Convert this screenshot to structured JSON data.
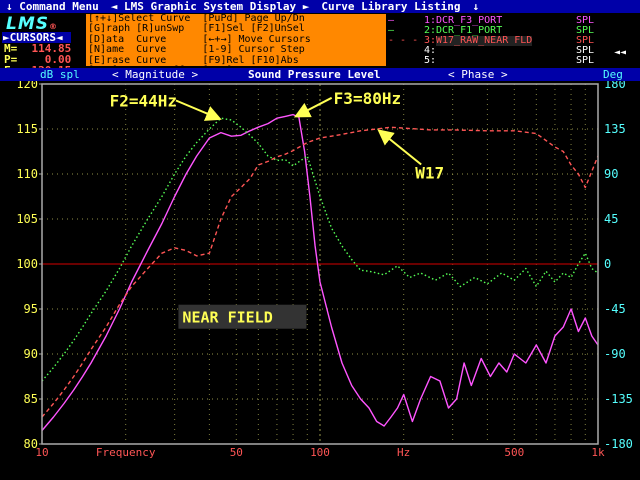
{
  "menubar": {
    "items": [
      {
        "label": "↓ Command Menu",
        "color": "#ffffff"
      },
      {
        "label": "◄ LMS Graphic System Display ►",
        "color": "#ffffff"
      },
      {
        "label": "Curve Library Listing",
        "color": "#ffffff"
      },
      {
        "label": "↓",
        "color": "#ffffff"
      }
    ]
  },
  "logo": {
    "text": "LMS",
    "mark": "®"
  },
  "cursors": {
    "title": "►CURSORS◄",
    "m_label": "M=",
    "m_value": "114.85",
    "p_label": "P=",
    "p_value": "0.00",
    "f_label": "F=",
    "f_value": "120.15"
  },
  "help_lines": [
    "[↑+↓]Select Curve  [PuPd] Page Up/Dn",
    "[G]raph [R]unSwp   [F1]Sel [F2]UnSel",
    "[D]ata  Curve      [←+→] Move Cursors",
    "[N]ame  Curve      [1-9] Cursor Step",
    "[E]rase Curve      [F9]Rel [F10]Abs",
    "[INS] Osc On/Off   [ESC] System Menu"
  ],
  "legend": {
    "rows": [
      {
        "num": "1:",
        "name": "DCR_F3_PORT",
        "type": "SPL",
        "color": "#ff55ff",
        "marker": "—"
      },
      {
        "num": "2:",
        "name": "DCR_F1_PORT",
        "type": "SPL",
        "color": "#55ff55",
        "marker": "—"
      },
      {
        "num": "3:",
        "name": "W17_RAW_NEAR FLD",
        "type": "SPL",
        "color": "#ff5555",
        "marker": "- - -",
        "selected": true
      },
      {
        "num": "4:",
        "name": "",
        "type": "SPL",
        "color": "#ffffff",
        "marker": ""
      },
      {
        "num": "5:",
        "name": "",
        "type": "SPL",
        "color": "#ffffff",
        "marker": ""
      }
    ],
    "scroll_icon": "◄◄"
  },
  "header": {
    "left_unit": "dB spl",
    "magnitude_tab": "< Magnitude >",
    "title": "Sound Pressure Level",
    "phase_tab": "< Phase >",
    "right_unit": "Deg"
  },
  "colors": {
    "plot_bg": "#000000",
    "frame": "#aaaaaa",
    "axis_left": "#ffff55",
    "axis_right": "#55ffff",
    "x_ticks": "#ff5555",
    "grid": "#aaaa55",
    "ref_line": "#aa0000",
    "annotation": "#ffff55"
  },
  "chart_data": {
    "type": "line",
    "title": "Sound Pressure Level",
    "xlabel": "Frequency",
    "x_unit": "Hz",
    "ylabel": "dB spl",
    "y2label": "Deg",
    "xscale": "log",
    "xlim": [
      10,
      1000
    ],
    "ylim": [
      80,
      120
    ],
    "y2lim": [
      -180,
      180
    ],
    "grid": true,
    "x_ticks": [
      {
        "value": 10,
        "label": "10"
      },
      {
        "value": 50,
        "label": "50"
      },
      {
        "value": 100,
        "label": "100"
      },
      {
        "value": 200,
        "label": "Hz"
      },
      {
        "value": 500,
        "label": "500"
      },
      {
        "value": 1000,
        "label": "1k"
      }
    ],
    "xlabel_at": 20,
    "y_ticks": [
      80,
      85,
      90,
      95,
      100,
      105,
      110,
      115,
      120
    ],
    "y2_ticks": [
      -180,
      -135,
      -90,
      -45,
      0,
      45,
      90,
      135,
      180
    ],
    "reference_line_y": 100,
    "annotations": [
      {
        "text": "F2=44Hz",
        "x": 17.5,
        "y": 117.5,
        "arrow_to": [
          43,
          116.2
        ]
      },
      {
        "text": "F3=80Hz",
        "x": 112,
        "y": 117.8,
        "arrow_to": [
          83,
          116.5
        ]
      },
      {
        "text": "W17",
        "x": 220,
        "y": 109.5,
        "arrow_to": [
          165,
          114.7
        ]
      },
      {
        "text": "NEAR FIELD",
        "x": 32,
        "y": 93.7,
        "boxed": true
      }
    ],
    "series": [
      {
        "name": "DCR_F3_PORT",
        "color": "#ff55ff",
        "style": "solid",
        "x": [
          10,
          11,
          12,
          13,
          14,
          15,
          17,
          19,
          21,
          24,
          27,
          30,
          33,
          36,
          40,
          44,
          48,
          52,
          56,
          60,
          65,
          70,
          75,
          80,
          84,
          88,
          92,
          96,
          100,
          110,
          120,
          130,
          140,
          150,
          160,
          170,
          180,
          190,
          200,
          215,
          230,
          250,
          270,
          290,
          310,
          330,
          350,
          380,
          410,
          440,
          470,
          500,
          550,
          600,
          650,
          700,
          750,
          800,
          850,
          900,
          950,
          1000
        ],
        "y": [
          81.5,
          83,
          84.5,
          86,
          87.5,
          89,
          92,
          95,
          98,
          101.5,
          104.5,
          107.5,
          110,
          112,
          114,
          114.6,
          114.2,
          114.3,
          114.8,
          115.2,
          115.6,
          116.2,
          116.4,
          116.6,
          116.3,
          112.5,
          107.5,
          102,
          98,
          93,
          89,
          86.5,
          85,
          84,
          82.5,
          82,
          83,
          84,
          85.5,
          82.5,
          85,
          87.5,
          87,
          84,
          85,
          89,
          86.5,
          89.5,
          87.5,
          89,
          88,
          90,
          89,
          91,
          89,
          92,
          93,
          95,
          92.5,
          94,
          92,
          91
        ]
      },
      {
        "name": "DCR_F1_PORT",
        "color": "#55ff55",
        "style": "dotted",
        "x": [
          10,
          11,
          12,
          13,
          14,
          15,
          17,
          19,
          21,
          24,
          27,
          30,
          33,
          36,
          40,
          44,
          48,
          52,
          56,
          60,
          65,
          70,
          75,
          80,
          90,
          100,
          110,
          120,
          130,
          140,
          150,
          170,
          190,
          210,
          230,
          260,
          290,
          320,
          360,
          400,
          450,
          500,
          550,
          600,
          650,
          700,
          750,
          800,
          850,
          900,
          950,
          1000
        ],
        "y": [
          87,
          88.5,
          90,
          91.5,
          93,
          94.5,
          97,
          99.5,
          102,
          105,
          107.5,
          110,
          112,
          113.5,
          115,
          116.2,
          116,
          115.2,
          114.3,
          113.4,
          112,
          111.5,
          111.6,
          110.9,
          112,
          107.5,
          104,
          102,
          100.5,
          99.3,
          99.2,
          98.8,
          99.8,
          98.5,
          99,
          98.2,
          99,
          97.5,
          98.5,
          97.8,
          99,
          98.2,
          99.5,
          97.5,
          99.2,
          98,
          99,
          98.5,
          100,
          101.2,
          99.5,
          99
        ]
      },
      {
        "name": "W17_RAW_NEAR FLD",
        "color": "#ff5555",
        "style": "dashed",
        "x": [
          10,
          11,
          12,
          13,
          14,
          15,
          17,
          19,
          21,
          24,
          27,
          30,
          33,
          36,
          40,
          44,
          48,
          52,
          56,
          60,
          65,
          70,
          75,
          80,
          90,
          100,
          110,
          120,
          140,
          160,
          180,
          200,
          250,
          300,
          400,
          500,
          600,
          700,
          750,
          800,
          850,
          900,
          950,
          1000
        ],
        "y": [
          83,
          84.5,
          86,
          87.5,
          89,
          90.5,
          93,
          95.5,
          97.5,
          99.5,
          101.2,
          101.8,
          101.5,
          100.9,
          101.2,
          105,
          107.5,
          108.5,
          109.5,
          111,
          111.4,
          111.9,
          112.2,
          112.6,
          113.5,
          114,
          114.2,
          114.4,
          114.8,
          115,
          115.2,
          115.1,
          114.9,
          114.9,
          114.8,
          114.8,
          114.5,
          113,
          112.5,
          111,
          110,
          108.5,
          110.3,
          112
        ]
      }
    ]
  }
}
